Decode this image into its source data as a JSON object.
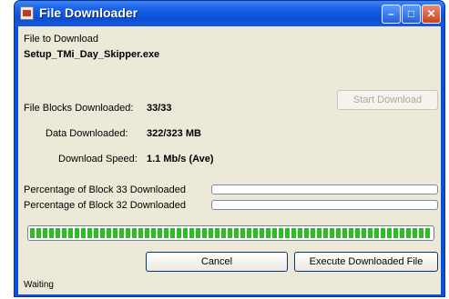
{
  "window": {
    "title": "File Downloader",
    "title_icon": "app-icon",
    "controls": {
      "minimize": "minimize-icon",
      "maximize": "maximize-icon",
      "close": "close-icon"
    }
  },
  "file": {
    "label": "File to Download",
    "name": "Setup_TMi_Day_Skipper.exe"
  },
  "stats": {
    "blocks_label": "File Blocks Downloaded:",
    "blocks_value": "33/33",
    "data_label": "Data Downloaded:",
    "data_value": "322/323 MB",
    "speed_label": "Download Speed:",
    "speed_value": "1.1 Mb/s (Ave)"
  },
  "progress": {
    "block33_label": "Percentage of Block 33 Downloaded",
    "block33_fraction": 0,
    "block32_label": "Percentage of Block 32 Downloaded",
    "block32_fraction": 0,
    "overall_fraction": 1.0
  },
  "buttons": {
    "start": "Start Download",
    "cancel": "Cancel",
    "execute": "Execute Downloaded File"
  },
  "status": "Waiting",
  "colors": {
    "titlebar": "#0a50d8",
    "progress_fill": "#2fbd26",
    "client_bg": "#ece9d8"
  }
}
